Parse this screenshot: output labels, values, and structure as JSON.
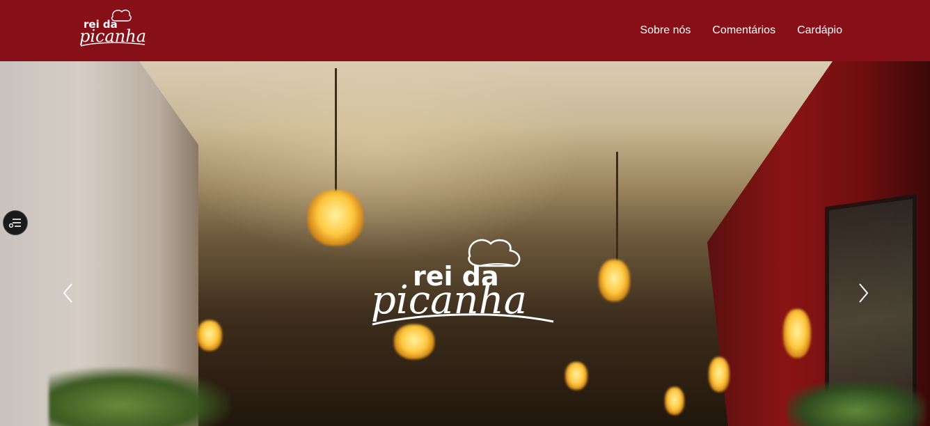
{
  "brand": {
    "logo_top": "rei da",
    "logo_bottom": "picanha"
  },
  "nav": {
    "items": [
      {
        "label": "Sobre nós"
      },
      {
        "label": "Comentários"
      },
      {
        "label": "Cardápio"
      }
    ]
  },
  "hero": {
    "logo_top": "rei da",
    "logo_bottom": "picanha",
    "prev_icon": "chevron-left-icon",
    "next_icon": "chevron-right-icon"
  },
  "widget": {
    "icon": "filter-settings-icon"
  },
  "colors": {
    "navbar": "#871018",
    "nav_text": "#ffffff"
  }
}
